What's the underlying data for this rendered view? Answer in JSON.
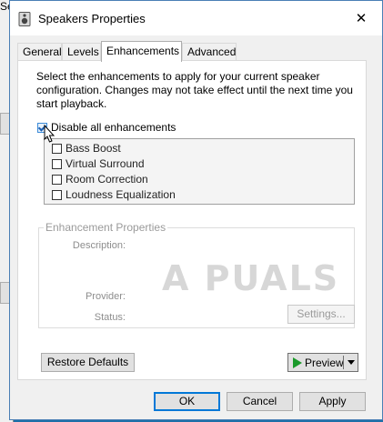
{
  "background": {
    "partial_text": "Sel"
  },
  "window": {
    "title": "Speakers Properties",
    "close_glyph": "✕"
  },
  "tabs": [
    {
      "label": "General"
    },
    {
      "label": "Levels"
    },
    {
      "label": "Enhancements"
    },
    {
      "label": "Advanced"
    }
  ],
  "active_tab": "Enhancements",
  "enhancements": {
    "description": "Select the enhancements to apply for your current speaker configuration. Changes may not take effect until the next time you start playback.",
    "disable_all_label": "Disable all enhancements",
    "disable_all_checked": true,
    "items": [
      {
        "label": "Bass Boost",
        "checked": false
      },
      {
        "label": "Virtual Surround",
        "checked": false
      },
      {
        "label": "Room Correction",
        "checked": false
      },
      {
        "label": "Loudness Equalization",
        "checked": false
      }
    ]
  },
  "properties": {
    "title": "Enhancement Properties",
    "description_label": "Description:",
    "provider_label": "Provider:",
    "status_label": "Status:",
    "settings_button": "Settings..."
  },
  "watermark": "A PUALS",
  "restore_defaults_button": "Restore Defaults",
  "preview_button": "Preview",
  "footer": {
    "ok": "OK",
    "cancel": "Cancel",
    "apply": "Apply"
  },
  "colors": {
    "desktop": "#1e6fa8",
    "focus_border": "#0078d7",
    "play_icon": "#1a9a2a"
  }
}
